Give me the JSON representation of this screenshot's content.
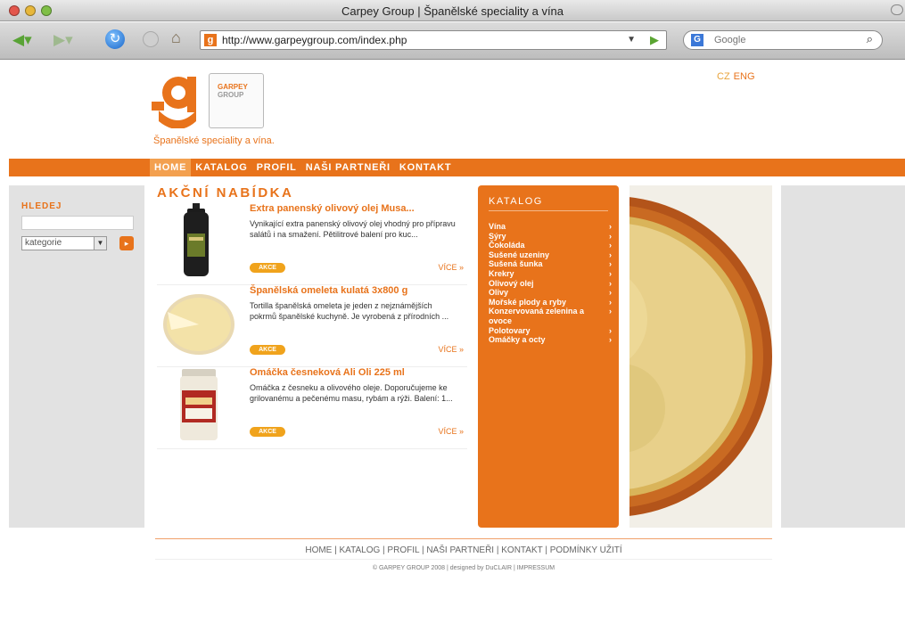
{
  "window": {
    "title": "Carpey Group | Španělské speciality a vína"
  },
  "browser": {
    "url": "http://www.garpeygroup.com/index.php",
    "search_placeholder": "Google",
    "search_engine_icon": "G",
    "favicon": "g"
  },
  "site": {
    "logo_box_line1": "GARPEY",
    "logo_box_line2": "GROUP",
    "tagline": "Španělské speciality a vína.",
    "lang": [
      "CZ",
      "ENG"
    ],
    "brand_color": "#e8731b"
  },
  "nav": [
    {
      "label": "HOME",
      "active": true
    },
    {
      "label": "KATALOG"
    },
    {
      "label": "PROFIL"
    },
    {
      "label": "NAŠI PARTNEŘI"
    },
    {
      "label": "KONTAKT"
    }
  ],
  "sidebar": {
    "search_label": "HLEDEJ",
    "category_select": "kategorie",
    "go_icon": "arrow-right-icon"
  },
  "offers": {
    "title": "AKČNÍ NABÍDKA",
    "items": [
      {
        "name": "Extra panenský olivový olej Musa...",
        "desc": "Vynikající extra panenský olivový olej vhodný pro přípravu salátů i na smažení. Pětilitrové balení pro kuc...",
        "badge": "AKCE",
        "more": "VÍCE »"
      },
      {
        "name": "Španělská omeleta kulatá 3x800 g",
        "desc": "Tortilla španělská omeleta je jeden z nejznámějších pokrmů španělské kuchyně. Je vyrobená z přírodních ...",
        "badge": "AKCE",
        "more": "VÍCE »"
      },
      {
        "name": "Omáčka česneková Ali Oli 225 ml",
        "desc": "Omáčka z česneku a olivového oleje. Doporučujeme ke grilovanému a pečenému masu, rybám a rýži. Balení: 1...",
        "badge": "AKCE",
        "more": "VÍCE »"
      }
    ]
  },
  "catalog": {
    "title": "KATALOG",
    "items": [
      "Vína",
      "Sýry",
      "Čokoláda",
      "Sušené uzeniny",
      "Sušená šunka",
      "Krekry",
      "Olivový olej",
      "Olivy",
      "Mořské plody a ryby",
      "Konzervovaná zelenina a ovoce",
      "Polotovary",
      "Omáčky a octy"
    ],
    "arrow": "›"
  },
  "footer": {
    "links": [
      "HOME",
      "KATALOG",
      "PROFIL",
      "NAŠI PARTNEŘI",
      "KONTAKT",
      "PODMÍNKY UŽITÍ"
    ],
    "separator": " | ",
    "copyright": "© GARPEY GROUP 2008 | designed by DuCLAIR | IMPRESSUM"
  }
}
